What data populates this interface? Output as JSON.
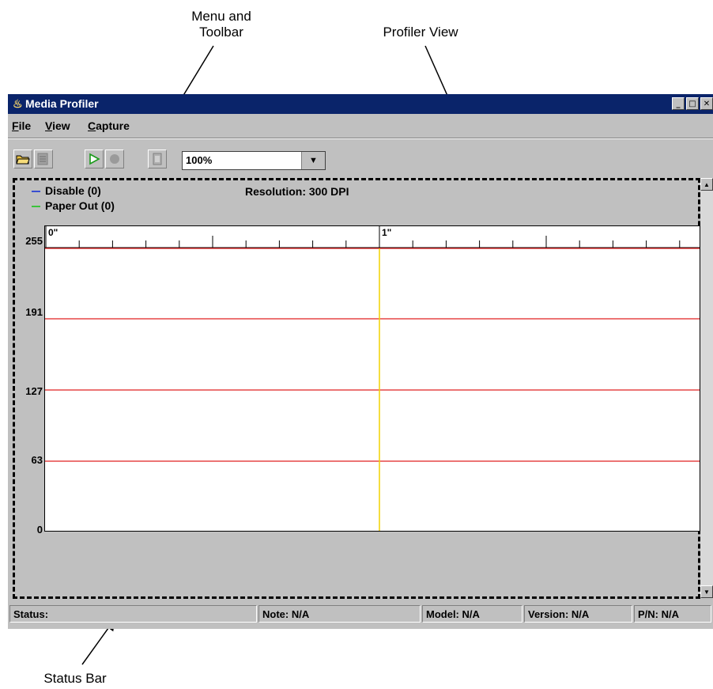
{
  "annotations": {
    "menu_toolbar": "Menu and\nToolbar",
    "profiler_view": "Profiler View",
    "status_bar": "Status Bar"
  },
  "window": {
    "title": "Media Profiler",
    "buttons": [
      "minimize-icon",
      "maximize-icon",
      "close-icon"
    ]
  },
  "menu": {
    "items": [
      {
        "label": "File"
      },
      {
        "label": "View"
      },
      {
        "label": "Capture"
      }
    ]
  },
  "toolbar": {
    "icons": [
      "open-folder-icon",
      "save-icon",
      "play-icon",
      "record-icon",
      "document-icon"
    ],
    "zoom_value": "100%"
  },
  "profiler": {
    "legend": [
      {
        "label": "Disable (0)",
        "color": "#3a4fd0"
      },
      {
        "label": "Paper Out (0)",
        "color": "#3cc43c"
      }
    ],
    "resolution": "Resolution: 300 DPI",
    "y_ticks": [
      "255",
      "191",
      "127",
      "63",
      "0"
    ],
    "ruler_labels": [
      "0\"",
      "1\""
    ],
    "threshold_color": "#e02020",
    "marker_color": "#f2d200"
  },
  "status": {
    "status": "Status:",
    "note": "Note: N/A",
    "model": "Model: N/A",
    "version": "Version: N/A",
    "pn": "P/N: N/A"
  }
}
